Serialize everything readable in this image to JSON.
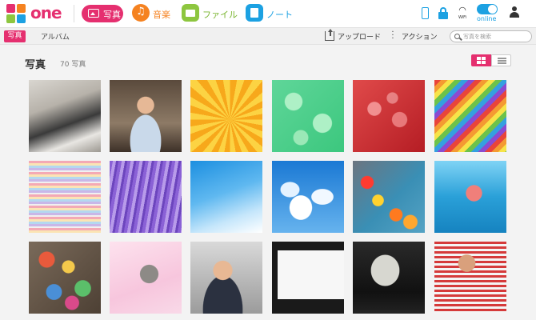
{
  "header": {
    "logo_text": "one",
    "nav": {
      "photo_label": "写真",
      "music_label": "音楽",
      "file_label": "ファイル",
      "note_label": "ノート"
    },
    "status": {
      "wifi_label": "WiFi",
      "online_label": "online"
    }
  },
  "subbar": {
    "tab_photo": "写真",
    "tab_album": "アルバム",
    "upload_label": "アップロード",
    "action_label": "アクション",
    "search_placeholder": "写真を検索"
  },
  "main": {
    "title": "写真",
    "count": "70 写真",
    "photos": [
      {
        "subject": "two people at a desk"
      },
      {
        "subject": "man smiling in cafe"
      },
      {
        "subject": "orange flower pattern"
      },
      {
        "subject": "green leaf pattern"
      },
      {
        "subject": "red bokeh"
      },
      {
        "subject": "rainbow stripes"
      },
      {
        "subject": "pastel horizontal stripes"
      },
      {
        "subject": "purple radial stripes"
      },
      {
        "subject": "blue sky"
      },
      {
        "subject": "sky with clouds"
      },
      {
        "subject": "flowers on water"
      },
      {
        "subject": "fish underwater"
      },
      {
        "subject": "colorful marbles"
      },
      {
        "subject": "cat on pink blanket"
      },
      {
        "subject": "smiling young man"
      },
      {
        "subject": "presentation slide imagination"
      },
      {
        "subject": "conference stage screen"
      },
      {
        "subject": "man in striped shirt"
      }
    ]
  },
  "colors": {
    "accent": "#e52f6f",
    "music": "#f58220",
    "file": "#8dc63f",
    "note": "#1ca1e2"
  }
}
